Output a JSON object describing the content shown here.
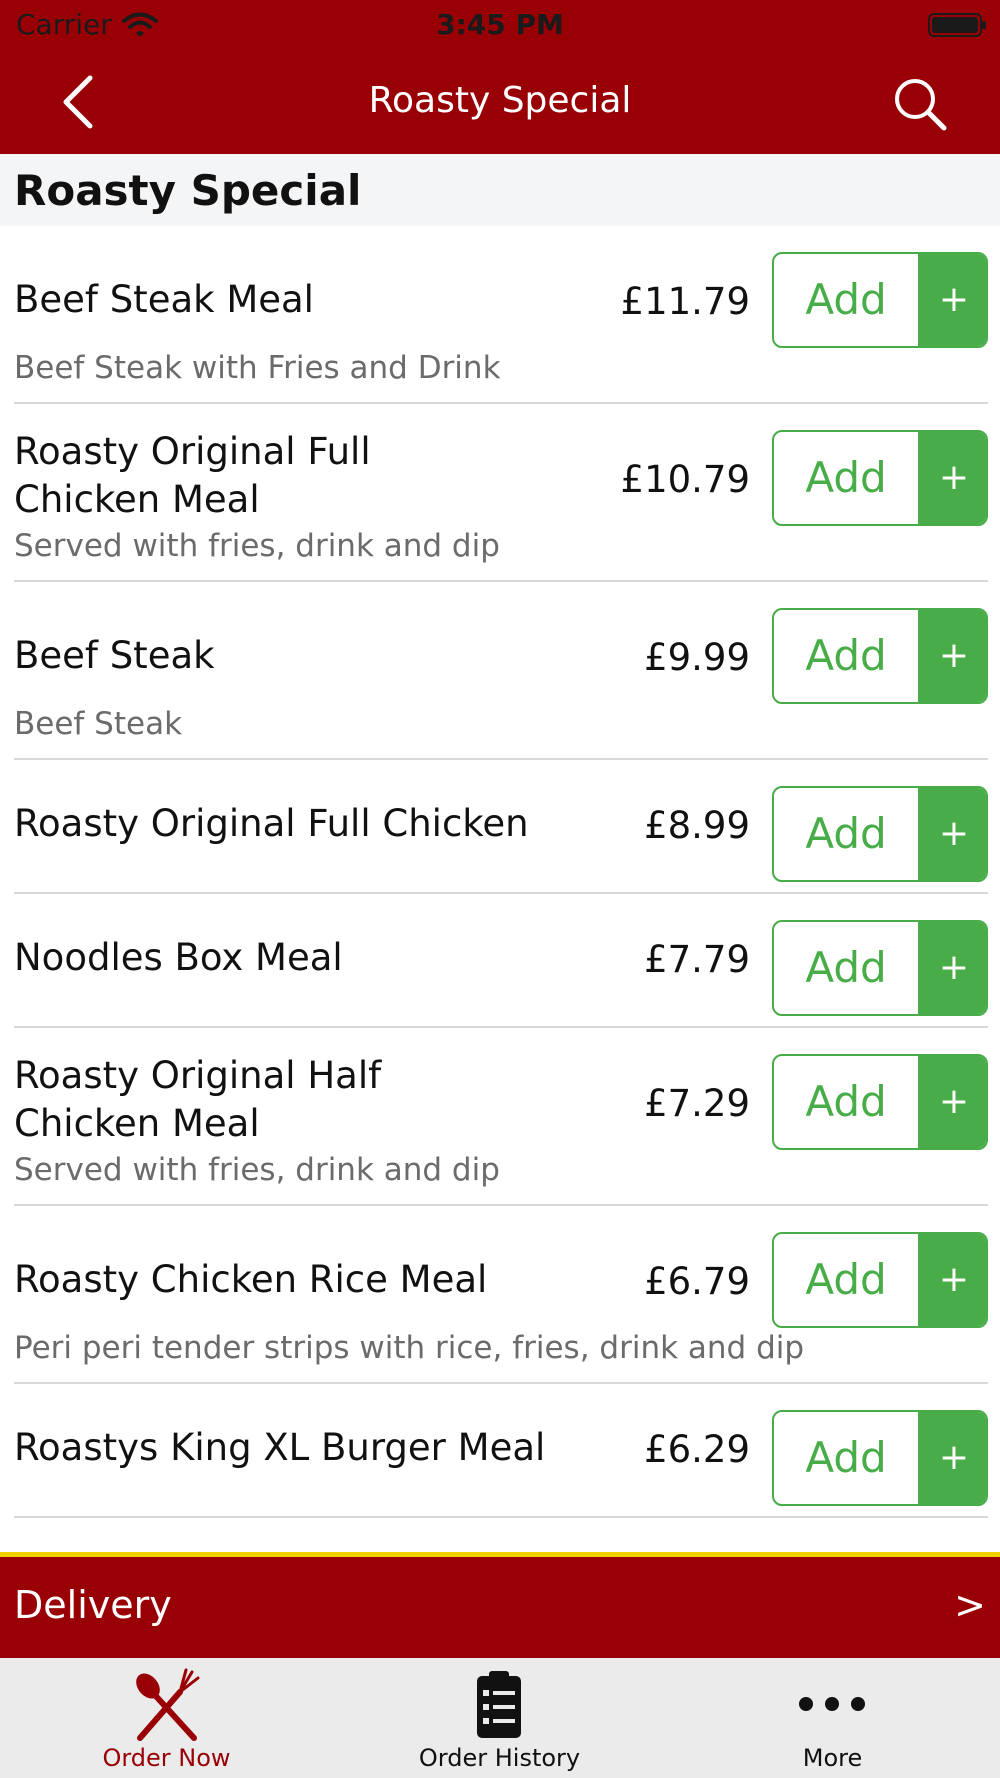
{
  "status_bar": {
    "carrier": "Carrier",
    "time": "3:45 PM"
  },
  "nav": {
    "title": "Roasty Special"
  },
  "section": {
    "title": "Roasty Special"
  },
  "add_label": "Add",
  "add_plus": "+",
  "items": [
    {
      "name": "Beef Steak Meal",
      "price": "£11.79",
      "description": "Beef Steak with Fries and Drink"
    },
    {
      "name": "Roasty Original Full\nChicken Meal",
      "price": "£10.79",
      "description": "Served with fries, drink and dip"
    },
    {
      "name": "Beef Steak",
      "price": "£9.99",
      "description": "Beef Steak"
    },
    {
      "name": "Roasty Original Full Chicken",
      "price": "£8.99",
      "description": ""
    },
    {
      "name": "Noodles Box Meal",
      "price": "£7.79",
      "description": ""
    },
    {
      "name": "Roasty Original Half\nChicken Meal",
      "price": "£7.29",
      "description": "Served with fries, drink and dip"
    },
    {
      "name": "Roasty Chicken Rice Meal",
      "price": "£6.79",
      "description": "Peri peri tender strips with rice, fries, drink and dip"
    },
    {
      "name": "Roastys King XL Burger Meal",
      "price": "£6.29",
      "description": ""
    }
  ],
  "delivery": {
    "label": "Delivery",
    "chevron": ">"
  },
  "tabs": [
    {
      "label": "Order Now",
      "icon": "fork-knife-icon",
      "active": true
    },
    {
      "label": "Order History",
      "icon": "clipboard-list-icon",
      "active": false
    },
    {
      "label": "More",
      "icon": "more-dots-icon",
      "active": false
    }
  ],
  "colors": {
    "brand": "#990005",
    "accent_green": "#48ad48",
    "highlight_yellow": "#f2d100"
  }
}
